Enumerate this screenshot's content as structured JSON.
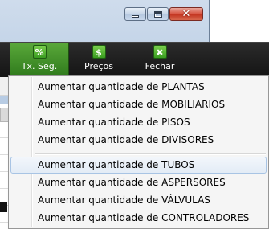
{
  "window": {
    "buttons": {
      "minimize_icon": "minimize-icon",
      "maximize_icon": "maximize-icon",
      "close_icon": "close-icon"
    }
  },
  "toolbar": {
    "items": [
      {
        "label": "Tx. Seg.",
        "icon_glyph": "%",
        "icon": "percent-icon",
        "active": true
      },
      {
        "label": "Preços",
        "icon_glyph": "$",
        "icon": "dollar-icon",
        "active": false
      },
      {
        "label": "Fechar",
        "icon_glyph": "✖",
        "icon": "close-icon",
        "active": false
      }
    ]
  },
  "context_menu": {
    "group1": [
      "Aumentar quantidade de PLANTAS",
      "Aumentar quantidade de MOBILIARIOS",
      "Aumentar quantidade de PISOS",
      "Aumentar quantidade de DIVISORES"
    ],
    "group2": [
      "Aumentar quantidade de TUBOS",
      "Aumentar quantidade de ASPERSORES",
      "Aumentar quantidade de VÁLVULAS",
      "Aumentar quantidade de CONTROLADORES"
    ],
    "highlighted": "Aumentar quantidade de TUBOS"
  },
  "colors": {
    "toolbar_active": "#3f8f27",
    "toolbar_bg": "#1c1c1c",
    "menu_highlight_border": "#a8c4e4"
  }
}
